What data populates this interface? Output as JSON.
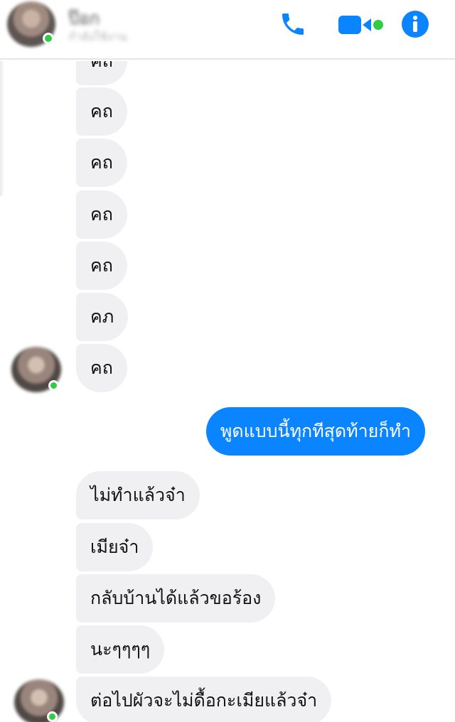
{
  "header": {
    "contact_name": "ป๊อก",
    "contact_status": "กำลังใช้งาน",
    "icons": [
      "phone-icon",
      "video-call-icon",
      "info-icon"
    ],
    "accent_color": "#0a84ff"
  },
  "messages": [
    {
      "side": "received",
      "text": "คถ"
    },
    {
      "side": "received",
      "text": "คถ"
    },
    {
      "side": "received",
      "text": "คถ"
    },
    {
      "side": "received",
      "text": "คถ"
    },
    {
      "side": "received",
      "text": "คถ"
    },
    {
      "side": "received",
      "text": "คภ"
    },
    {
      "side": "received",
      "text": "คถ"
    },
    {
      "side": "sent",
      "text": "พูดแบบนี้ทุกทีสุดท้ายก็ทำ"
    },
    {
      "side": "received",
      "text": "ไม่ทำแล้วจ๋า"
    },
    {
      "side": "received",
      "text": "เมียจ๋า"
    },
    {
      "side": "received",
      "text": "กลับบ้านได้แล้วขอร้อง"
    },
    {
      "side": "received",
      "text": "นะๆๆๆๆ"
    },
    {
      "side": "received",
      "text": "ต่อไปผัวจะไม่ดื้อกะเมียแล้วจ๋า"
    }
  ]
}
